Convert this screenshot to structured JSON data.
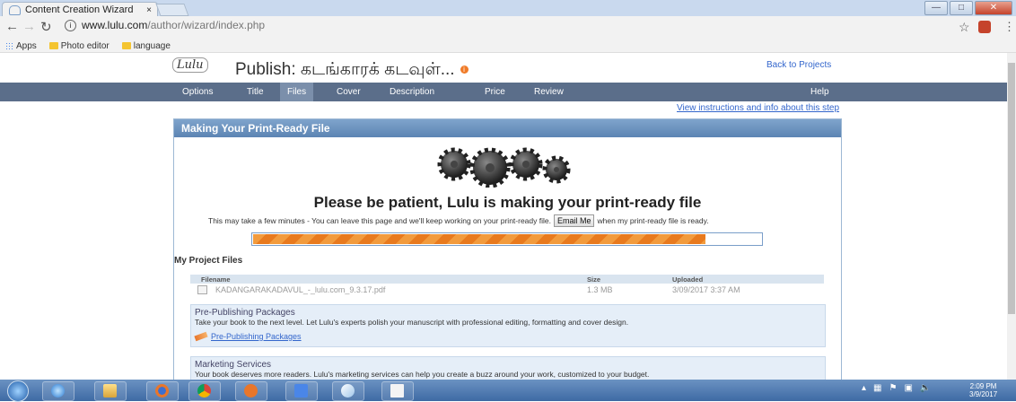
{
  "browser": {
    "tab_title": "Content Creation Wizard",
    "tab_close": "×",
    "url_host": "www.lulu.com",
    "url_path": "/author/wizard/index.php",
    "bookmarks": [
      "Apps",
      "Photo editor",
      "language"
    ]
  },
  "header": {
    "logo": "Lulu",
    "title": "Publish: கடங்காரக் கடவுள்...",
    "back_link": "Back to Projects"
  },
  "nav": {
    "items": [
      "Options",
      "Title",
      "Files",
      "Cover",
      "Description",
      "Price",
      "Review"
    ],
    "active": "Files",
    "help": "Help"
  },
  "instructions_link": "View instructions and info about this step",
  "panel": {
    "heading": "Making Your Print-Ready File",
    "patient_message": "Please be patient, Lulu is making your print-ready file",
    "wait_before": "This may take a few minutes - You can leave this page and we'll keep working on your print-ready file.",
    "email_button": "Email Me",
    "wait_after": "when my print-ready file is ready.",
    "progress": 0.89,
    "progress_color": "#e87a1e",
    "my_project_files": "My Project Files",
    "files_table": {
      "columns": [
        "Filename",
        "Size",
        "Uploaded"
      ],
      "rows": [
        {
          "filename": "KADANGARAKADAVUL_-_lulu.com_9.3.17.pdf",
          "size": "1.3 MB",
          "uploaded": "3/09/2017 3:37 AM"
        }
      ]
    },
    "pre_publishing": {
      "title": "Pre-Publishing Packages",
      "text": "Take your book to the next level. Let Lulu's experts polish your manuscript with professional editing, formatting and cover design.",
      "link": "Pre-Publishing Packages"
    },
    "marketing": {
      "title": "Marketing Services",
      "text": "Your book deserves more readers. Lulu's marketing services can help you create a buzz around your work, customized to your budget."
    }
  },
  "taskbar": {
    "time": "2:09 PM",
    "date": "3/9/2017"
  },
  "colors": {
    "nav_bar": "#5b6e8a",
    "panel_header": "#5c84b3",
    "link": "#3366cc"
  }
}
